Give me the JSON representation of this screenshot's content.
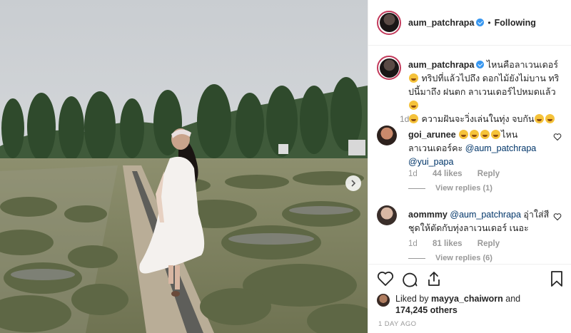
{
  "post": {
    "author": "aum_patchrapa",
    "follow_status": "Following",
    "separator": "•"
  },
  "caption": {
    "username": "aum_patchrapa",
    "text_1": " ไหนคือลาเวนเดอร์",
    "text_2": " ทริปที่แล้วไปถึง ดอกไม้ยังไม่บาน ทริปนี้มาถึง ฝนตก ลาเวนเดอร์ไปหมดแล้ว",
    "text_3": " ความฝันจะวิ่งเล่นในทุ่ง จบกัน",
    "time": "1d"
  },
  "comments": [
    {
      "username": "goi_arunee",
      "text": "ไหนลาเวนเดอร์คะ",
      "mention_1": "@aum_patchrapa",
      "mention_2": "@yui_papa",
      "time": "1d",
      "likes": "44 likes",
      "reply": "Reply",
      "view_replies": "View replies (1)"
    },
    {
      "username": "aommmy",
      "mention_1": "@aum_patchrapa",
      "text": " อุ่าใส่สีชุดให้ตัดกับทุ่งลาเวนเดอร์ เนอะ",
      "time": "1d",
      "likes": "81 likes",
      "reply": "Reply",
      "view_replies": "View replies (6)"
    }
  ],
  "likes": {
    "prefix": "Liked by ",
    "user": "mayya_chaiworn",
    "and": " and",
    "count": "174,245 others"
  },
  "timestamp": "1 DAY AGO",
  "icons": [
    "verified-badge-icon",
    "heart-icon",
    "comment-icon",
    "share-icon",
    "bookmark-icon",
    "chevron-right-icon",
    "heart-small-icon"
  ],
  "colors": {
    "verified": "#3897f0",
    "story_ring": "#c23a5b",
    "mention": "#003569",
    "meta": "#999999"
  }
}
